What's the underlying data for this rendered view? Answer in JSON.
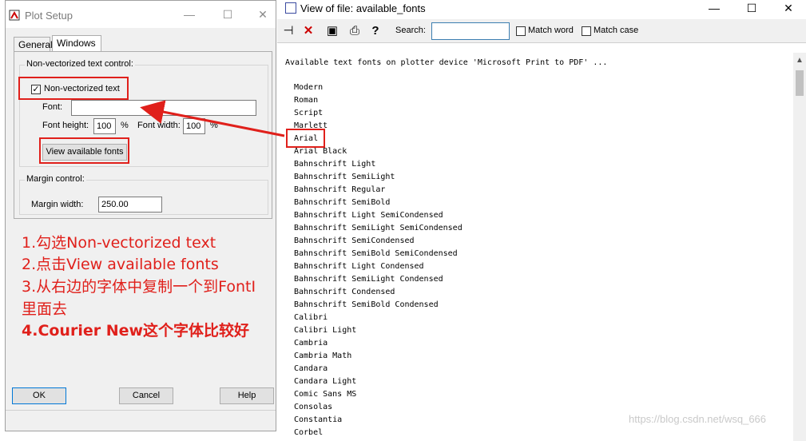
{
  "plot_setup": {
    "title": "Plot Setup",
    "window_controls": {
      "minimize": "—",
      "maximize": "☐",
      "close": "✕"
    },
    "tabs": [
      "General",
      "Windows"
    ],
    "active_tab": "Windows",
    "nonvec_group_title": "Non-vectorized text control:",
    "nonvec_checkbox_label": "Non-vectorized text",
    "nonvec_checked": true,
    "font_label": "Font:",
    "font_value": "",
    "font_height_label": "Font height:",
    "font_height_value": "100",
    "font_height_unit": "%",
    "font_width_label": "Font width:",
    "font_width_value": "100",
    "font_width_unit": "%",
    "view_fonts_button": "View available fonts",
    "margin_group_title": "Margin control:",
    "margin_width_label": "Margin width:",
    "margin_width_value": "250.00",
    "ok_button": "OK",
    "cancel_button": "Cancel",
    "help_button": "Help"
  },
  "annotations": [
    "1.勾选Non-vectorized text",
    "2.点击View available fonts",
    "3.从右边的字体中复制一个到FontI",
    "里面去",
    "4.Courier New这个字体比较好"
  ],
  "accent_color": "#e0201b",
  "viewer": {
    "title": "View of file: available_fonts",
    "window_controls": {
      "minimize": "—",
      "maximize": "☐",
      "close": "✕"
    },
    "toolbar_icons": [
      "pin-icon",
      "close-file-icon",
      "save-icon",
      "print-icon",
      "help-icon"
    ],
    "search_label": "Search:",
    "search_value": "",
    "match_word_label": "Match word",
    "match_case_label": "Match case",
    "header_line": "Available text fonts on plotter device 'Microsoft Print to PDF' ...",
    "fonts": [
      "Modern",
      "Roman",
      "Script",
      "Marlett",
      "Arial",
      "Arial Black",
      "Bahnschrift Light",
      "Bahnschrift SemiLight",
      "Bahnschrift Regular",
      "Bahnschrift SemiBold",
      "Bahnschrift Light SemiCondensed",
      "Bahnschrift SemiLight SemiCondensed",
      "Bahnschrift SemiCondensed",
      "Bahnschrift SemiBold SemiCondensed",
      "Bahnschrift Light Condensed",
      "Bahnschrift SemiLight Condensed",
      "Bahnschrift Condensed",
      "Bahnschrift SemiBold Condensed",
      "Calibri",
      "Calibri Light",
      "Cambria",
      "Cambria Math",
      "Candara",
      "Candara Light",
      "Comic Sans MS",
      "Consolas",
      "Constantia",
      "Corbel"
    ],
    "highlighted_font": "Arial",
    "watermark": "https://blog.csdn.net/wsq_666"
  }
}
